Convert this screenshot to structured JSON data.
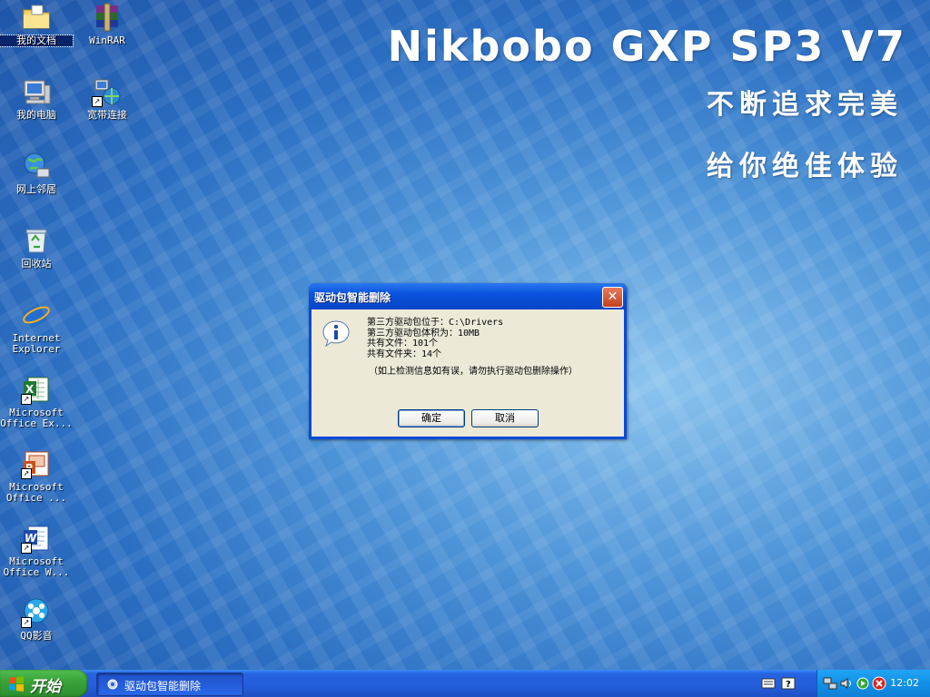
{
  "wallpaper": {
    "title": "Nikbobo GXP SP3 V7",
    "line1": "不断追求完美",
    "line2": "给你绝佳体验"
  },
  "desktop_icons": [
    {
      "label": "我的文档",
      "icon": "folder-documents-icon",
      "selected": true
    },
    {
      "label": "WinRAR",
      "icon": "winrar-icon"
    },
    {
      "label": "我的电脑",
      "icon": "computer-icon"
    },
    {
      "label": "宽带连接",
      "icon": "network-connection-icon"
    },
    {
      "label": "网上邻居",
      "icon": "network-globe-icon"
    },
    {
      "label": "回收站",
      "icon": "recycle-bin-icon"
    },
    {
      "label": "Internet",
      "label2": "Explorer",
      "icon": "internet-explorer-icon"
    },
    {
      "label": "Microsoft",
      "label2": "Office Ex...",
      "icon": "excel-icon"
    },
    {
      "label": "Microsoft",
      "label2": "Office ...",
      "icon": "powerpoint-icon"
    },
    {
      "label": "Microsoft",
      "label2": "Office W...",
      "icon": "word-icon"
    },
    {
      "label": "QQ影音",
      "icon": "qq-player-icon"
    }
  ],
  "dialog": {
    "title": "驱动包智能删除",
    "lines": [
      "第三方驱动包位于：C:\\Drivers",
      "第三方驱动包体积为：10MB",
      "共有文件：101个",
      "共有文件夹：14个"
    ],
    "note": "（如上检测信息如有误，请勿执行驱动包删除操作）",
    "ok_label": "确定",
    "cancel_label": "取消",
    "close_glyph": "✕"
  },
  "taskbar": {
    "start_label": "开始",
    "task_label": "驱动包智能删除",
    "clock": "12:02"
  },
  "colors": {
    "titlebar": "#0a52de",
    "taskbar": "#245edb",
    "start": "#3aa43a",
    "tray": "#1290e6"
  }
}
